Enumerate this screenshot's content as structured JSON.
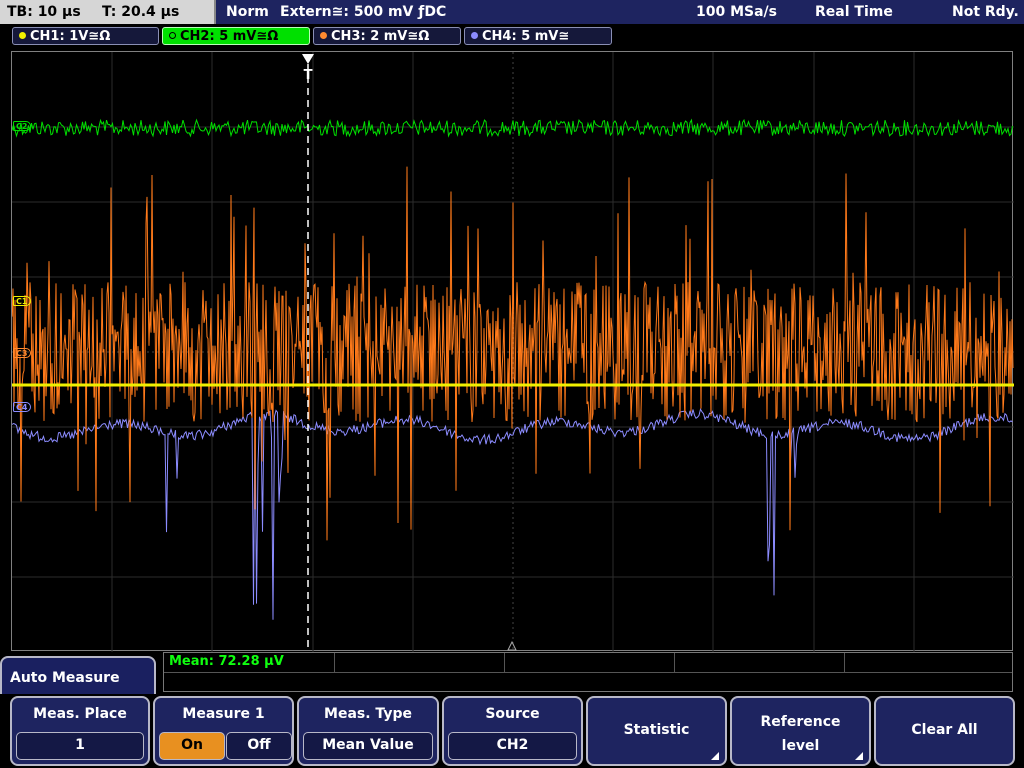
{
  "status": {
    "timebase": "TB: 10 µs",
    "trigger_time": "T: 20.4 µs",
    "trigger_mode": "Norm",
    "trigger_source": "Extern≅: 500 mV ƒDC",
    "sample_rate": "100 MSa/s",
    "acq_mode": "Real Time",
    "state": "Not Rdy."
  },
  "channels": [
    {
      "label": "CH1: 1V≅Ω",
      "color": "#f0f000",
      "marker": "C1"
    },
    {
      "label": "CH2: 5 mV≅Ω",
      "color": "#00e000",
      "marker": "C2"
    },
    {
      "label": "CH3: 2 mV≅Ω",
      "color": "#ff8a30",
      "marker": "C3"
    },
    {
      "label": "CH4: 5 mV≅",
      "color": "#8c8cff",
      "marker": "C4"
    }
  ],
  "trigger_marker": "T",
  "measurement": {
    "text": "Mean: 72.28 µV"
  },
  "menu": {
    "title": "Auto Measure",
    "meas_place": {
      "label": "Meas. Place",
      "value": "1"
    },
    "measure1": {
      "label": "Measure 1",
      "on": "On",
      "off": "Off",
      "state": "On"
    },
    "meas_type": {
      "label": "Meas. Type",
      "value": "Mean Value"
    },
    "source": {
      "label": "Source",
      "value": "CH2"
    },
    "statistic": {
      "label": "Statistic"
    },
    "reference": {
      "line1": "Reference",
      "line2": "level"
    },
    "clear_all": {
      "label": "Clear All"
    }
  },
  "icons": [
    "trigger-position-icon",
    "submenu-arrow-icon",
    "channel-dot-icon"
  ]
}
